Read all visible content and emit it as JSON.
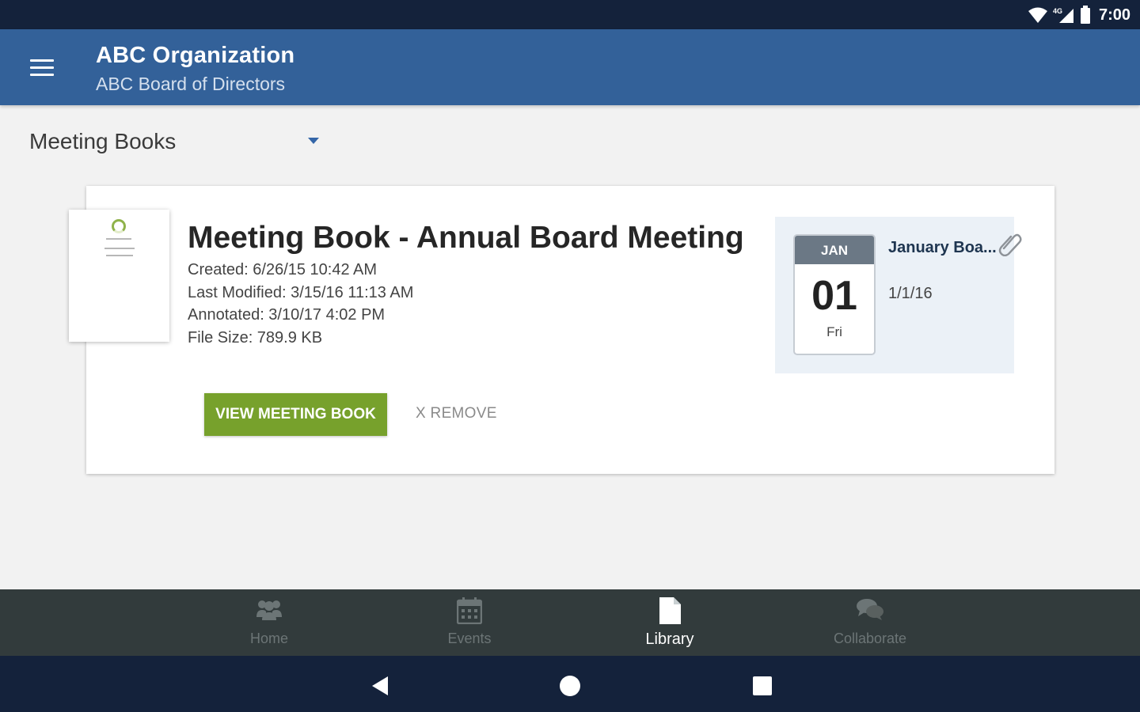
{
  "status_bar": {
    "time": "7:00",
    "network_label": "4G"
  },
  "app_bar": {
    "title": "ABC Organization",
    "subtitle": "ABC Board of Directors"
  },
  "filter": {
    "selected": "Meeting Books"
  },
  "meeting_book": {
    "title": "Meeting Book - Annual Board Meeting",
    "created": "Created: 6/26/15 10:42 AM",
    "last_modified": "Last Modified: 3/15/16 11:13 AM",
    "annotated": "Annotated: 3/10/17 4:02 PM",
    "file_size": "File Size: 789.9 KB",
    "view_button": "VIEW MEETING BOOK",
    "remove_button": "X REMOVE"
  },
  "event": {
    "month": "JAN",
    "day": "01",
    "weekday": "Fri",
    "name": "January Boa...",
    "date": "1/1/16"
  },
  "bottom_nav": {
    "items": [
      {
        "label": "Home",
        "icon": "people-icon",
        "active": false
      },
      {
        "label": "Events",
        "icon": "calendar-icon",
        "active": false
      },
      {
        "label": "Library",
        "icon": "document-icon",
        "active": true
      },
      {
        "label": "Collaborate",
        "icon": "chat-icon",
        "active": false
      }
    ]
  },
  "colors": {
    "app_bar": "#336199",
    "status_bar": "#14223b",
    "primary_button": "#77a12c",
    "bottom_nav": "#323b3c"
  }
}
